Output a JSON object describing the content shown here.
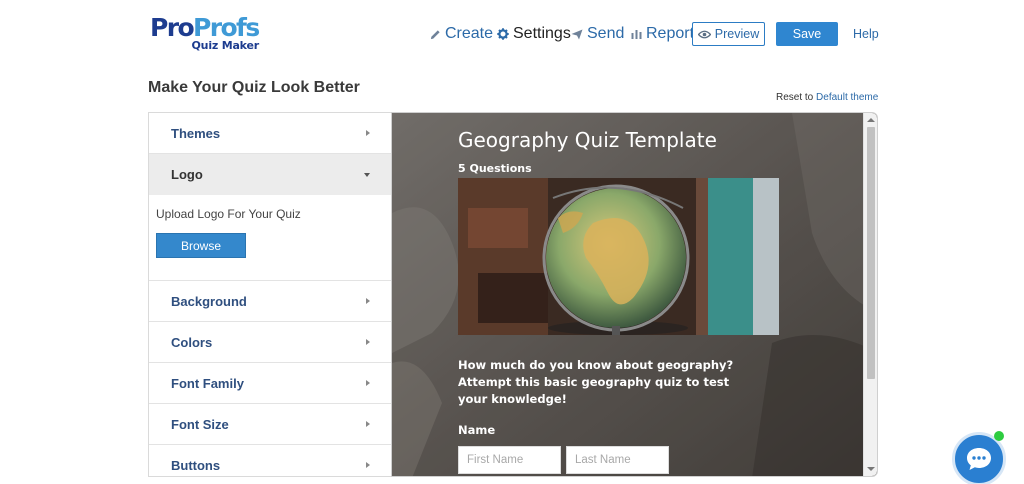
{
  "brand": {
    "pro": "Pro",
    "profs": "Profs",
    "sub": "Quiz Maker"
  },
  "nav": {
    "create": "Create",
    "settings": "Settings",
    "send": "Send",
    "reports": "Reports",
    "preview": "Preview",
    "save": "Save",
    "help": "Help"
  },
  "page": {
    "title": "Make Your Quiz Look Better",
    "reset_prefix": "Reset to",
    "reset_link": "Default theme"
  },
  "sidebar": {
    "items": [
      {
        "label": "Themes"
      },
      {
        "label": "Logo"
      },
      {
        "label": "Background"
      },
      {
        "label": "Colors"
      },
      {
        "label": "Font Family"
      },
      {
        "label": "Font Size"
      },
      {
        "label": "Buttons"
      }
    ],
    "logo_panel": {
      "upload_label": "Upload Logo For Your Quiz",
      "browse": "Browse"
    }
  },
  "quiz": {
    "title": "Geography Quiz Template",
    "question_count": "5 Questions",
    "description": "How much do you know about geography? Attempt this basic geography quiz to test your knowledge!",
    "name_label": "Name",
    "first_name_placeholder": "First Name",
    "last_name_placeholder": "Last Name"
  },
  "colors": {
    "accent": "#2f86d0",
    "link": "#2c6aa8",
    "brand_dark": "#1d3c8f",
    "brand_light": "#3f9ad6",
    "online": "#2ecc40"
  }
}
